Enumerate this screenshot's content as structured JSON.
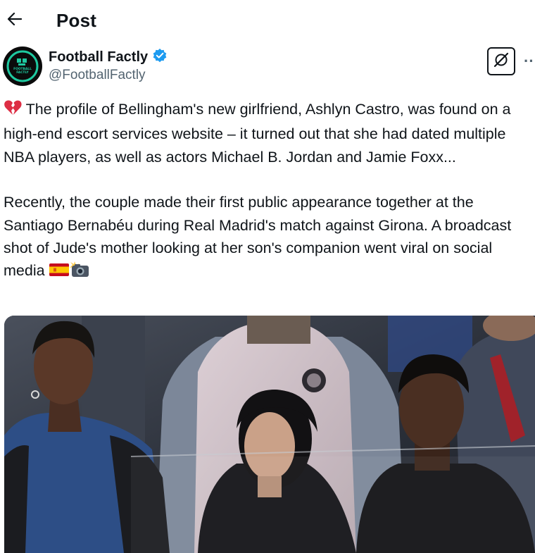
{
  "header": {
    "title": "Post",
    "back_icon": "arrow-left-icon"
  },
  "author": {
    "display_name": "Football Factly",
    "handle": "@FootballFactly",
    "verified": true,
    "verified_color": "#1d9bf0",
    "avatar_icon": "football-factly-logo",
    "avatar_logo_text": "FOOTBALL FACTLY"
  },
  "actions": {
    "grok_icon": "grok-icon",
    "more_label": "··"
  },
  "tweet": {
    "paragraph1": "The profile of Bellingham's new girlfriend, Ashlyn Castro, was found on a high-end escort services website – it turned out that she had dated multiple NBA players, as well as actors Michael B. Jordan and Jamie Foxx...",
    "paragraph2": "Recently, the couple made their first public appearance together at the Santiago Bernabéu during Real Madrid's match against Girona. A broadcast shot of Jude's mother looking at her son's companion went viral on social media",
    "emoji_lead": "broken-heart-emoji",
    "emoji_trail": [
      "spain-flag-emoji",
      "camera-flash-emoji"
    ]
  },
  "media": {
    "type": "photo",
    "subject": "stadium-stand-photo"
  },
  "colors": {
    "text": "#0f1419",
    "secondary": "#536471",
    "accent": "#1d9bf0"
  }
}
